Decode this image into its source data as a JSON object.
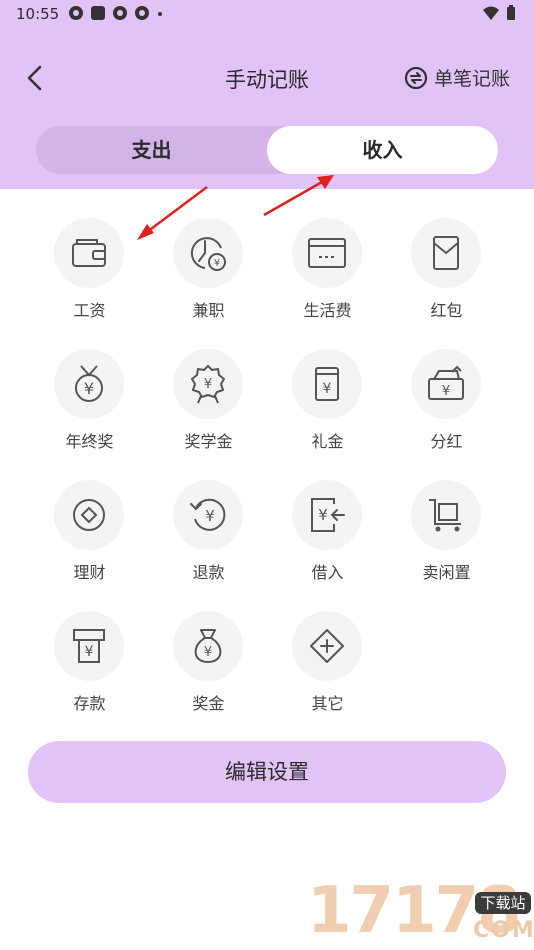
{
  "status_bar": {
    "time": "10:55"
  },
  "header": {
    "title": "手动记账",
    "single_label": "单笔记账"
  },
  "tabs": {
    "expense": "支出",
    "income": "收入",
    "active": "income"
  },
  "categories": [
    {
      "label": "工资",
      "icon": "wallet-icon"
    },
    {
      "label": "兼职",
      "icon": "clock-yen-icon"
    },
    {
      "label": "生活费",
      "icon": "card-icon"
    },
    {
      "label": "红包",
      "icon": "red-envelope-icon"
    },
    {
      "label": "年终奖",
      "icon": "medal-yen-icon"
    },
    {
      "label": "奖学金",
      "icon": "award-badge-icon"
    },
    {
      "label": "礼金",
      "icon": "gift-envelope-icon"
    },
    {
      "label": "分红",
      "icon": "dividend-box-icon"
    },
    {
      "label": "理财",
      "icon": "coin-icon"
    },
    {
      "label": "退款",
      "icon": "refund-icon"
    },
    {
      "label": "借入",
      "icon": "borrow-icon"
    },
    {
      "label": "卖闲置",
      "icon": "cart-icon"
    },
    {
      "label": "存款",
      "icon": "deposit-icon"
    },
    {
      "label": "奖金",
      "icon": "money-bag-icon"
    },
    {
      "label": "其它",
      "icon": "diamond-plus-icon"
    }
  ],
  "edit_button": "编辑设置",
  "watermark": {
    "text": "17178",
    "badge": "下载站",
    "suffix": "COM"
  },
  "colors": {
    "header": "#e2c3f7",
    "segment": "#d3b3e8",
    "icon_bg": "#f4f4f5",
    "arrow": "#e0201d"
  }
}
